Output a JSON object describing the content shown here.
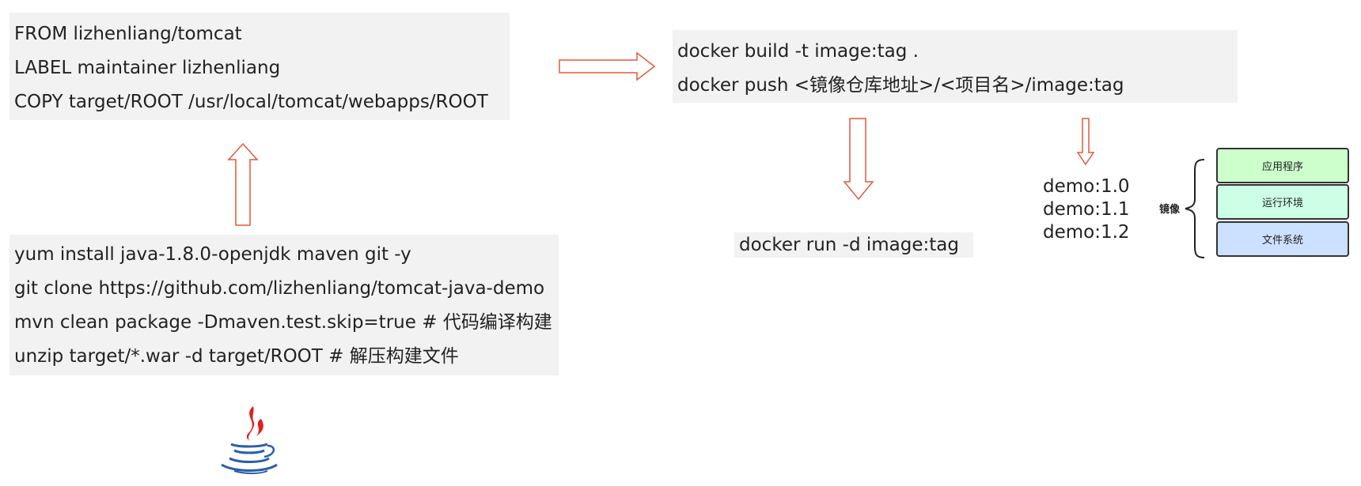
{
  "dockerfile": {
    "lines": [
      "FROM lizhenliang/tomcat",
      "LABEL maintainer lizhenliang",
      "COPY target/ROOT /usr/local/tomcat/webapps/ROOT"
    ]
  },
  "build_steps": {
    "lines": [
      "yum install java-1.8.0-openjdk maven git -y",
      "git clone https://github.com/lizhenliang/tomcat-java-demo",
      "mvn clean package -Dmaven.test.skip=true   # 代码编译构建",
      "unzip target/*.war -d target/ROOT  # 解压构建文件"
    ]
  },
  "docker_cmds": {
    "lines": [
      "docker build -t image:tag .",
      "docker push <镜像仓库地址>/<项目名>/image:tag"
    ]
  },
  "run_cmd": "docker run -d image:tag",
  "tags": [
    "demo:1.0",
    "demo:1.1",
    "demo:1.2"
  ],
  "image_layers": {
    "label": "镜像",
    "layers": [
      {
        "label": "应用程序",
        "color": "#ccffcc"
      },
      {
        "label": "运行环境",
        "color": "#ccffe6"
      },
      {
        "label": "文件系统",
        "color": "#cce0ff"
      }
    ]
  },
  "colors": {
    "arrow": "#e05a3a",
    "box_bg": "#f2f2f2",
    "java_red": "#e02020",
    "java_blue": "#2a5ea8"
  },
  "icons": {
    "java_logo": "java-logo-icon"
  }
}
